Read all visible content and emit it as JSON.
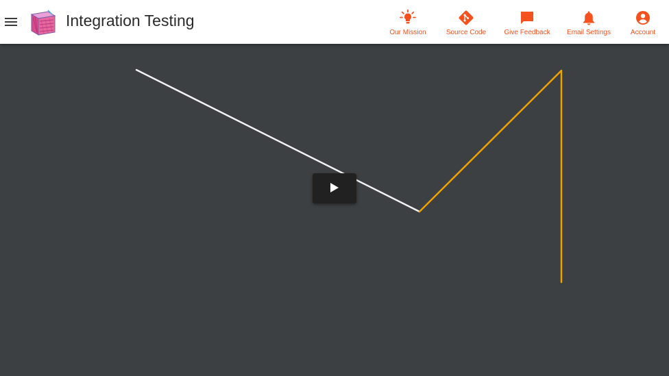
{
  "app": {
    "title": "Integration Testing"
  },
  "nav": [
    {
      "label": "Our Mission",
      "icon": "lightbulb-icon"
    },
    {
      "label": "Source Code",
      "icon": "git-icon"
    },
    {
      "label": "Give Feedback",
      "icon": "feedback-icon"
    },
    {
      "label": "Email Settings",
      "icon": "bell-icon"
    },
    {
      "label": "Account",
      "icon": "account-icon"
    }
  ],
  "colors": {
    "accent": "#f4511e",
    "canvas_bg": "#3c4042",
    "white_line": "#f2f2f2",
    "orange_line": "#f0a300"
  },
  "player": {
    "state": "paused"
  }
}
